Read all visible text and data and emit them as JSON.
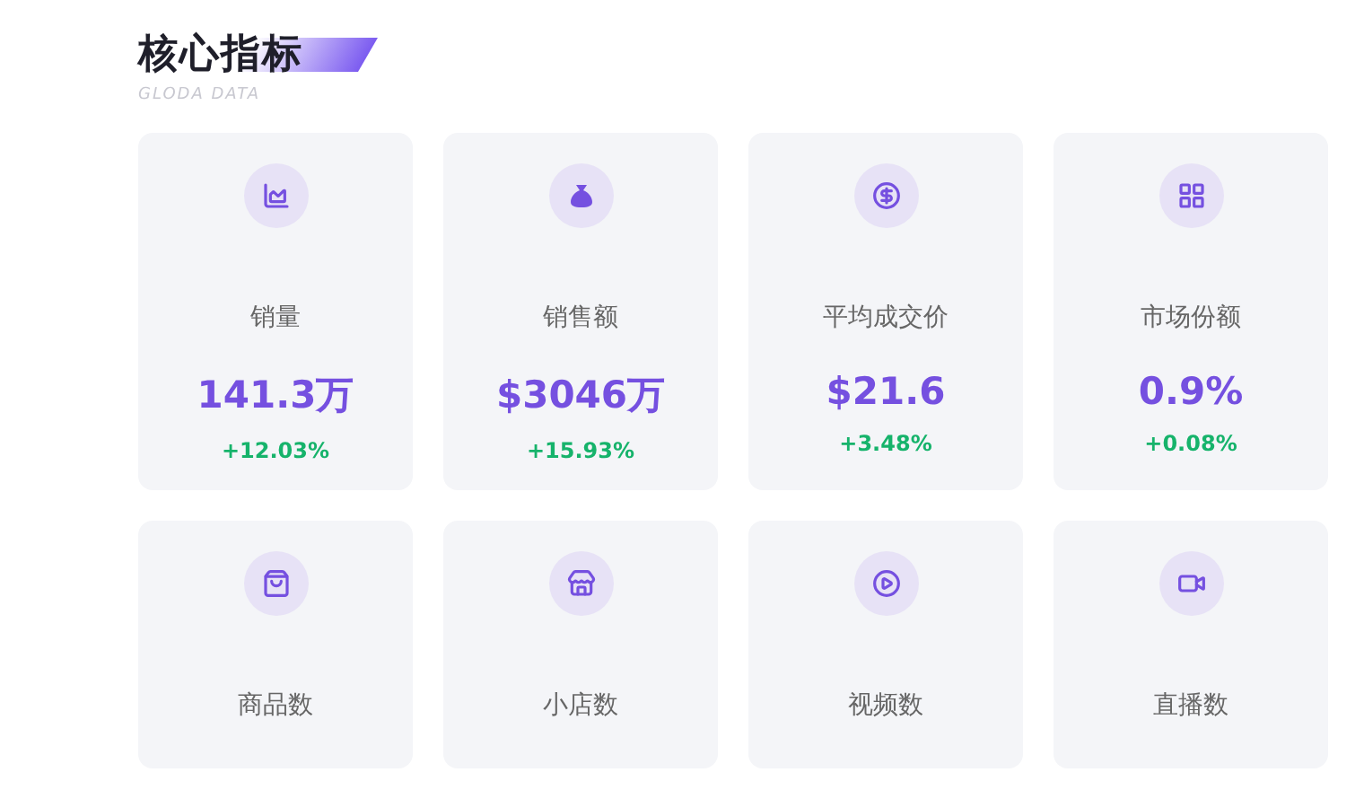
{
  "header": {
    "title": "核心指标",
    "subtitle": "GLODA DATA"
  },
  "metrics": [
    {
      "label": "销量",
      "value": "141.3万",
      "change": "+12.03%"
    },
    {
      "label": "销售额",
      "value": "$3046万",
      "change": "+15.93%"
    },
    {
      "label": "平均成交价",
      "value": "$21.6",
      "change": "+3.48%"
    },
    {
      "label": "市场份额",
      "value": "0.9%",
      "change": "+0.08%"
    },
    {
      "label": "商品数"
    },
    {
      "label": "小店数"
    },
    {
      "label": "视频数"
    },
    {
      "label": "直播数"
    }
  ]
}
